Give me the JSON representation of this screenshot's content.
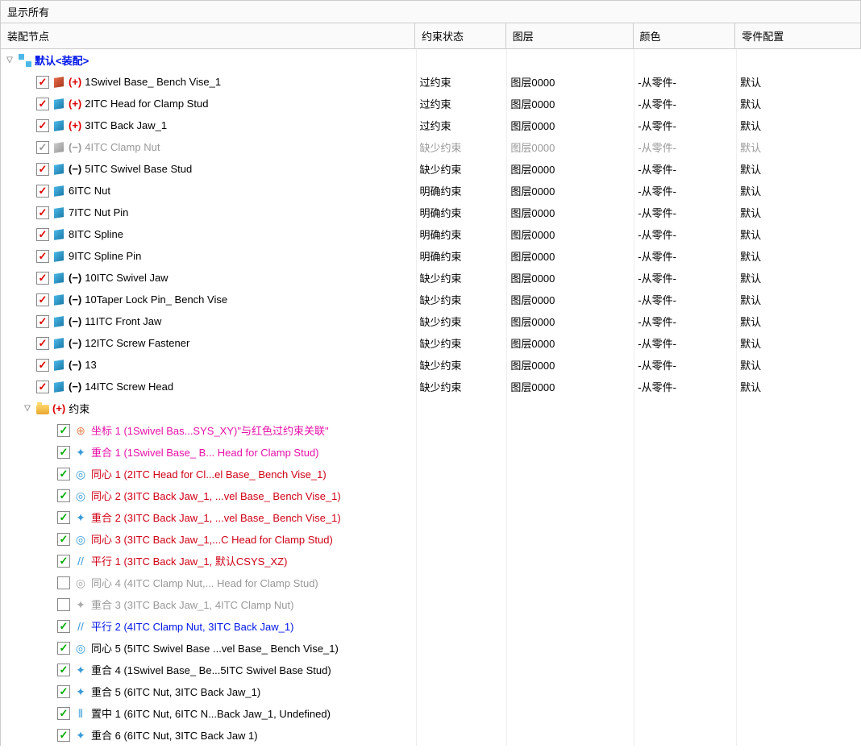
{
  "header": {
    "display_all": "显示所有"
  },
  "columns": {
    "c1": "装配节点",
    "c2": "约束状态",
    "c3": "图层",
    "c4": "颜色",
    "c5": "零件配置"
  },
  "root": {
    "label": "默认<装配>"
  },
  "constraint_folder": {
    "label": "约束"
  },
  "status": {
    "over": "过约束",
    "missing": "缺少约束",
    "defined": "明确约束"
  },
  "common": {
    "layer": "图层0000",
    "color": "-从零件-",
    "config": "默认",
    "plus": "(+)",
    "minus": "(−)"
  },
  "parts": [
    {
      "name": "1Swivel Base_ Bench Vise_1",
      "sign": "plus",
      "status": "over",
      "icon": "red",
      "checked": true,
      "enabled": true
    },
    {
      "name": "2ITC Head for Clamp Stud",
      "sign": "plus",
      "status": "over",
      "icon": "blue",
      "checked": true,
      "enabled": true
    },
    {
      "name": "3ITC Back Jaw_1",
      "sign": "plus",
      "status": "over",
      "icon": "blue",
      "checked": true,
      "enabled": true
    },
    {
      "name": "4ITC Clamp Nut",
      "sign": "minus",
      "status": "missing",
      "icon": "grey",
      "checked": true,
      "enabled": false
    },
    {
      "name": "5ITC Swivel Base Stud",
      "sign": "minus",
      "status": "missing",
      "icon": "blue",
      "checked": true,
      "enabled": true
    },
    {
      "name": "6ITC Nut",
      "sign": "",
      "status": "defined",
      "icon": "blue",
      "checked": true,
      "enabled": true
    },
    {
      "name": "7ITC Nut Pin",
      "sign": "",
      "status": "defined",
      "icon": "blue",
      "checked": true,
      "enabled": true
    },
    {
      "name": "8ITC Spline",
      "sign": "",
      "status": "defined",
      "icon": "blue",
      "checked": true,
      "enabled": true
    },
    {
      "name": "9ITC Spline Pin",
      "sign": "",
      "status": "defined",
      "icon": "blue",
      "checked": true,
      "enabled": true
    },
    {
      "name": "10ITC Swivel Jaw",
      "sign": "minus",
      "status": "missing",
      "icon": "blue",
      "checked": true,
      "enabled": true
    },
    {
      "name": "10Taper Lock Pin_ Bench Vise",
      "sign": "minus",
      "status": "missing",
      "icon": "blue",
      "checked": true,
      "enabled": true
    },
    {
      "name": "11ITC Front Jaw",
      "sign": "minus",
      "status": "missing",
      "icon": "blue",
      "checked": true,
      "enabled": true
    },
    {
      "name": "12ITC Screw Fastener",
      "sign": "minus",
      "status": "missing",
      "icon": "blue",
      "checked": true,
      "enabled": true
    },
    {
      "name": "13",
      "sign": "minus",
      "status": "missing",
      "icon": "blue",
      "checked": true,
      "enabled": true
    },
    {
      "name": "14ITC Screw Head",
      "sign": "minus",
      "status": "missing",
      "icon": "blue",
      "checked": true,
      "enabled": true
    }
  ],
  "constraints": [
    {
      "glyph": "coord",
      "label": "坐标 1 (1Swivel Bas...SYS_XY)\"与红色过约束关联\"",
      "color": "magenta",
      "checked": true
    },
    {
      "glyph": "coincident",
      "label": "重合 1 (1Swivel Base_ B... Head for Clamp Stud)",
      "color": "magenta",
      "checked": true
    },
    {
      "glyph": "concentric",
      "label": "同心 1 (2ITC Head for Cl...el Base_ Bench Vise_1)",
      "color": "red",
      "checked": true
    },
    {
      "glyph": "concentric",
      "label": "同心 2 (3ITC Back Jaw_1, ...vel Base_ Bench Vise_1)",
      "color": "red",
      "checked": true
    },
    {
      "glyph": "coincident",
      "label": "重合 2 (3ITC Back Jaw_1, ...vel Base_ Bench Vise_1)",
      "color": "red",
      "checked": true
    },
    {
      "glyph": "concentric",
      "label": "同心 3 (3ITC Back Jaw_1,...C Head for Clamp Stud)",
      "color": "red",
      "checked": true
    },
    {
      "glyph": "parallel",
      "label": "平行 1 (3ITC Back Jaw_1, 默认CSYS_XZ)",
      "color": "red",
      "checked": true
    },
    {
      "glyph": "concentric",
      "label": "同心 4 (4ITC Clamp Nut,... Head for Clamp Stud)",
      "color": "grey",
      "checked": false
    },
    {
      "glyph": "coincident",
      "label": "重合 3 (3ITC Back Jaw_1, 4ITC Clamp Nut)",
      "color": "grey",
      "checked": false
    },
    {
      "glyph": "parallel",
      "label": "平行 2 (4ITC Clamp Nut, 3ITC Back Jaw_1)",
      "color": "link",
      "checked": true
    },
    {
      "glyph": "concentric",
      "label": "同心 5 (5ITC Swivel Base ...vel Base_ Bench Vise_1)",
      "color": "black",
      "checked": true
    },
    {
      "glyph": "coincident",
      "label": "重合 4 (1Swivel Base_ Be...5ITC Swivel Base Stud)",
      "color": "black",
      "checked": true
    },
    {
      "glyph": "coincident",
      "label": "重合 5 (6ITC Nut, 3ITC Back Jaw_1)",
      "color": "black",
      "checked": true
    },
    {
      "glyph": "center",
      "label": "置中 1 (6ITC Nut, 6ITC N...Back Jaw_1, Undefined)",
      "color": "black",
      "checked": true
    },
    {
      "glyph": "coincident",
      "label": "重合 6 (6ITC Nut, 3ITC Back Jaw 1)",
      "color": "black",
      "checked": true
    }
  ]
}
